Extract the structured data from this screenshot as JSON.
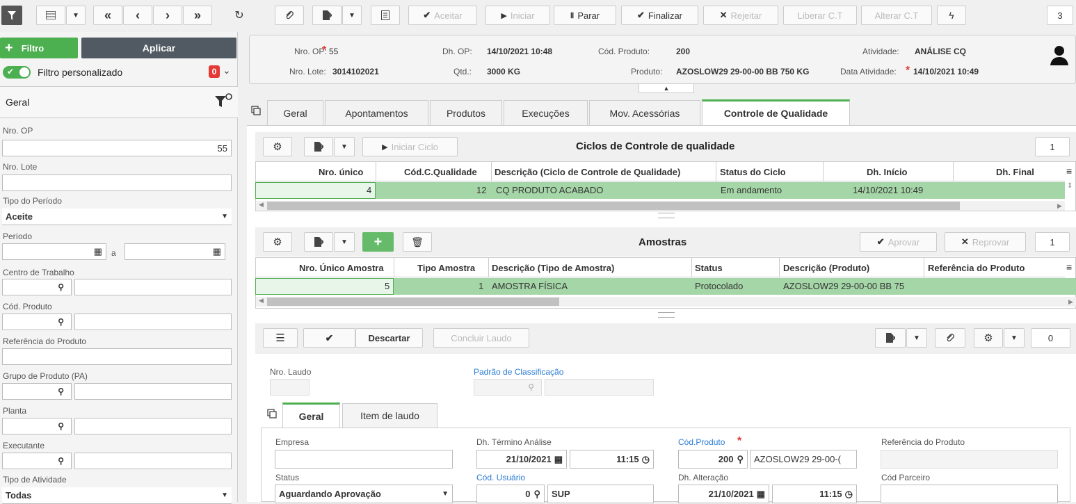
{
  "toolbar": {
    "aceitar": "Aceitar",
    "iniciar": "Iniciar",
    "parar": "Parar",
    "finalizar": "Finalizar",
    "rejeitar": "Rejeitar",
    "liberar": "Liberar C.T",
    "alterar": "Alterar C.T",
    "count": "3"
  },
  "sidebar": {
    "filtro": "Filtro",
    "aplicar": "Aplicar",
    "filtro_personalizado": "Filtro personalizado",
    "badge": "0",
    "geral": "Geral",
    "nro_op_label": "Nro. OP",
    "nro_op_value": "55",
    "nro_lote_label": "Nro. Lote",
    "tipo_periodo_label": "Tipo do Período",
    "tipo_periodo_value": "Aceite",
    "periodo_label": "Período",
    "periodo_a": "a",
    "centro_label": "Centro de Trabalho",
    "cod_produto_label": "Cód. Produto",
    "ref_produto_label": "Referência do Produto",
    "grupo_label": "Grupo de Produto (PA)",
    "planta_label": "Planta",
    "executante_label": "Executante",
    "tipo_atividade_label": "Tipo de Atividade",
    "tipo_atividade_value": "Todas"
  },
  "header": {
    "nro_op_label": "Nro. OP:",
    "nro_op": "55",
    "nro_lote_label": "Nro. Lote:",
    "nro_lote": "3014102021",
    "dh_op_label": "Dh. OP:",
    "dh_op": "14/10/2021 10:48",
    "qtd_label": "Qtd.:",
    "qtd": "3000 KG",
    "cod_produto_label": "Cód. Produto:",
    "cod_produto": "200",
    "produto_label": "Produto:",
    "produto": "AZOSLOW29 29-00-00 BB 750 KG",
    "atividade_label": "Atividade:",
    "atividade": "ANÁLISE CQ",
    "data_atividade_label": "Data Atividade:",
    "data_atividade": "14/10/2021 10:49"
  },
  "tabs": [
    "Geral",
    "Apontamentos",
    "Produtos",
    "Execuções",
    "Mov. Acessórias",
    "Controle de Qualidade"
  ],
  "ciclos": {
    "iniciar_ciclo": "Iniciar Ciclo",
    "title": "Ciclos de Controle de qualidade",
    "count": "1",
    "columns": [
      "Nro. único",
      "Cód.C.Qualidade",
      "Descrição (Ciclo de Controle de Qualidade)",
      "Status do Ciclo",
      "Dh. Início",
      "Dh. Final"
    ],
    "row": [
      "4",
      "12",
      "CQ PRODUTO ACABADO",
      "Em andamento",
      "14/10/2021 10:49",
      ""
    ]
  },
  "amostras": {
    "title": "Amostras",
    "aprovar": "Aprovar",
    "reprovar": "Reprovar",
    "count": "1",
    "columns": [
      "Nro. Único Amostra",
      "Tipo Amostra",
      "Descrição (Tipo de Amostra)",
      "Status",
      "Descrição (Produto)",
      "Referência do Produto"
    ],
    "row": [
      "5",
      "1",
      "AMOSTRA FÍSICA",
      "Protocolado",
      "AZOSLOW29 29-00-00 BB 75",
      ""
    ]
  },
  "laudo": {
    "descartar": "Descartar",
    "concluir": "Concluir Laudo",
    "count": "0",
    "nro_laudo_label": "Nro. Laudo",
    "padrao_label": "Padrão de Classificação",
    "tab_geral": "Geral",
    "tab_item": "Item de laudo",
    "empresa_label": "Empresa",
    "dh_termino_label": "Dh. Término Análise",
    "dh_termino_date": "21/10/2021",
    "dh_termino_time": "11:15",
    "cod_produto_label": "Cód.Produto",
    "cod_produto": "200",
    "produto_desc": "AZOSLOW29 29-00-(",
    "ref_produto_label": "Referência do Produto",
    "status_label": "Status",
    "status_value": "Aguardando Aprovação",
    "cod_usuario_label": "Cód. Usuário",
    "cod_usuario": "0",
    "usuario": "SUP",
    "dh_alteracao_label": "Dh. Alteração",
    "dh_alteracao_date": "21/10/2021",
    "dh_alteracao_time": "11:15",
    "cod_parceiro_label": "Cód Parceiro"
  }
}
